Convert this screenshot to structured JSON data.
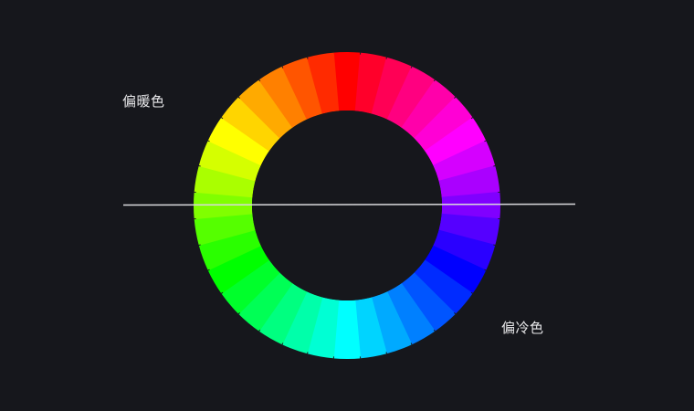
{
  "labels": {
    "warm": "偏暖色",
    "cool": "偏冷色"
  },
  "wheel": {
    "segments": 36,
    "hue_step_degrees": 10,
    "start_hue": 0,
    "background_color": "#16171c",
    "tick_color": "#1b1c22"
  },
  "divider": {
    "color": "#d9d9dc"
  }
}
